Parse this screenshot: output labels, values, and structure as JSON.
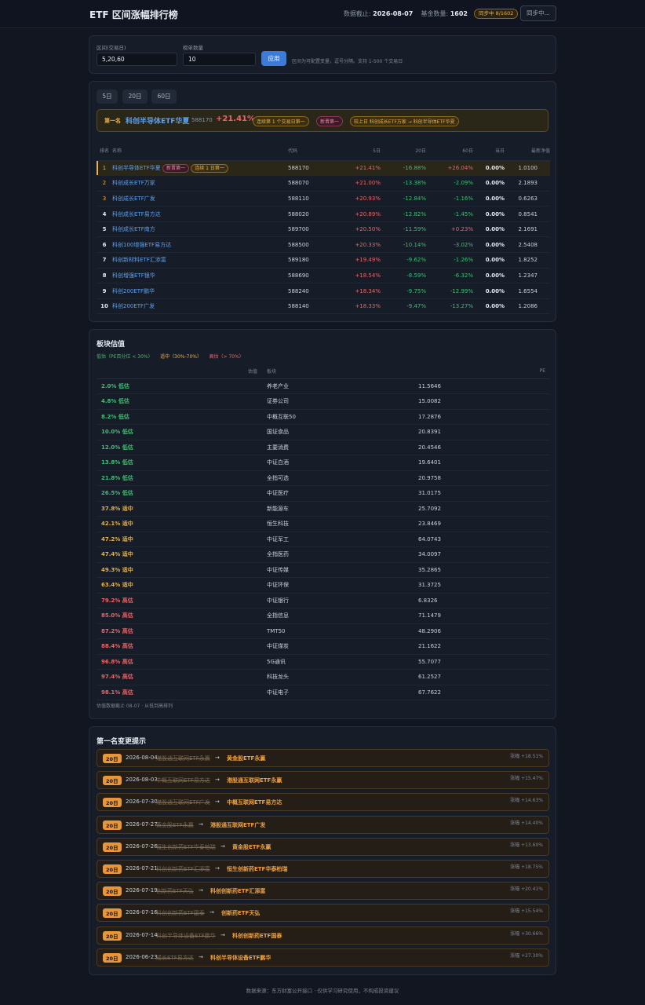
{
  "header": {
    "title": "ETF 区间涨幅排行榜",
    "date_label": "数据截止:",
    "date_value": "2026-08-07",
    "count_label": "基金数量:",
    "count_value": "1602",
    "sync_badge": "同步中 8/1602",
    "sync_button": "同步中..."
  },
  "controls": {
    "range_label": "区间(交易日)",
    "range_value": "5,20,60",
    "limit_label": "榜单数量",
    "limit_value": "10",
    "apply_label": "应用",
    "hint": "区间为可配置变量，逗号分隔。支持 1-500 个交易日"
  },
  "tabs": [
    "5日",
    "20日",
    "60日"
  ],
  "leader": {
    "prefix": "第一名",
    "name": "科创半导体ETF华夏",
    "code": "588170",
    "pct": "+21.41%",
    "pill1": "连续第 1 个交易日第一",
    "pill2": "新晋第一",
    "pill3": "较上日 科创成长ETF万家 → 科创半导体ETF华夏"
  },
  "rank_table": {
    "headers": [
      "排名",
      "名称",
      "代码",
      "5日",
      "20日",
      "60日",
      "当日",
      "最新净值"
    ],
    "rows": [
      {
        "rank": "1",
        "name": "科创半导体ETF华夏",
        "code": "588170",
        "d5": "+21.41%",
        "d20": "-16.88%",
        "d60": "+26.04%",
        "today": "0.00%",
        "nav": "1.0100",
        "tag1": "新晋第一",
        "tag2": "连续 1 日第一"
      },
      {
        "rank": "2",
        "name": "科创成长ETF万家",
        "code": "588070",
        "d5": "+21.00%",
        "d20": "-13.38%",
        "d60": "-2.09%",
        "today": "0.00%",
        "nav": "2.1893"
      },
      {
        "rank": "3",
        "name": "科创成长ETF广发",
        "code": "588110",
        "d5": "+20.93%",
        "d20": "-12.84%",
        "d60": "-1.16%",
        "today": "0.00%",
        "nav": "0.6263"
      },
      {
        "rank": "4",
        "name": "科创成长ETF易方达",
        "code": "588020",
        "d5": "+20.89%",
        "d20": "-12.82%",
        "d60": "-1.45%",
        "today": "0.00%",
        "nav": "0.8541"
      },
      {
        "rank": "5",
        "name": "科创成长ETF南方",
        "code": "589700",
        "d5": "+20.50%",
        "d20": "-11.59%",
        "d60": "+0.23%",
        "today": "0.00%",
        "nav": "2.1691"
      },
      {
        "rank": "6",
        "name": "科创100增强ETF易方达",
        "code": "588500",
        "d5": "+20.33%",
        "d20": "-10.14%",
        "d60": "-3.02%",
        "today": "0.00%",
        "nav": "2.5408"
      },
      {
        "rank": "7",
        "name": "科创新材料ETF汇添富",
        "code": "589180",
        "d5": "+19.49%",
        "d20": "-9.62%",
        "d60": "-1.26%",
        "today": "0.00%",
        "nav": "1.8252"
      },
      {
        "rank": "8",
        "name": "科创增强ETF银华",
        "code": "588690",
        "d5": "+18.54%",
        "d20": "-8.59%",
        "d60": "-6.32%",
        "today": "0.00%",
        "nav": "1.2347"
      },
      {
        "rank": "9",
        "name": "科创200ETF鹏华",
        "code": "588240",
        "d5": "+18.34%",
        "d20": "-9.75%",
        "d60": "-12.99%",
        "today": "0.00%",
        "nav": "1.6554"
      },
      {
        "rank": "10",
        "name": "科创200ETF广发",
        "code": "588140",
        "d5": "+18.33%",
        "d20": "-9.47%",
        "d60": "-13.27%",
        "today": "0.00%",
        "nav": "1.2086"
      }
    ]
  },
  "valuation": {
    "title": "板块估值",
    "legend_low": "低估（PE百分位 < 30%）",
    "legend_mid": "适中（30%-70%）",
    "legend_high": "高估（> 70%）",
    "headers": [
      "估值",
      "板块",
      "PE"
    ],
    "rows": [
      {
        "level": "2.0% 低估",
        "sector": "养老产业",
        "pe": "11.5646",
        "cls": "lv-low"
      },
      {
        "level": "4.8% 低估",
        "sector": "证券公司",
        "pe": "15.0082",
        "cls": "lv-low"
      },
      {
        "level": "8.2% 低估",
        "sector": "中概互联50",
        "pe": "17.2876",
        "cls": "lv-low"
      },
      {
        "level": "10.0% 低估",
        "sector": "国证食品",
        "pe": "20.8391",
        "cls": "lv-low"
      },
      {
        "level": "12.0% 低估",
        "sector": "主要消费",
        "pe": "20.4546",
        "cls": "lv-low"
      },
      {
        "level": "13.8% 低估",
        "sector": "中证白酒",
        "pe": "19.6401",
        "cls": "lv-low"
      },
      {
        "level": "21.8% 低估",
        "sector": "全指可选",
        "pe": "20.9758",
        "cls": "lv-low"
      },
      {
        "level": "26.5% 低估",
        "sector": "中证医疗",
        "pe": "31.0175",
        "cls": "lv-low"
      },
      {
        "level": "37.8% 适中",
        "sector": "新能源车",
        "pe": "25.7092",
        "cls": "lv-mid"
      },
      {
        "level": "42.1% 适中",
        "sector": "恒生科技",
        "pe": "23.8469",
        "cls": "lv-mid"
      },
      {
        "level": "47.2% 适中",
        "sector": "中证军工",
        "pe": "64.0743",
        "cls": "lv-mid"
      },
      {
        "level": "47.4% 适中",
        "sector": "全指医药",
        "pe": "34.0097",
        "cls": "lv-mid"
      },
      {
        "level": "49.3% 适中",
        "sector": "中证传媒",
        "pe": "35.2865",
        "cls": "lv-mid"
      },
      {
        "level": "63.4% 适中",
        "sector": "中证环保",
        "pe": "31.3725",
        "cls": "lv-mid"
      },
      {
        "level": "79.2% 高估",
        "sector": "中证银行",
        "pe": "6.8326",
        "cls": "lv-high"
      },
      {
        "level": "85.0% 高估",
        "sector": "全指信息",
        "pe": "71.1479",
        "cls": "lv-high"
      },
      {
        "level": "87.2% 高估",
        "sector": "TMT50",
        "pe": "48.2906",
        "cls": "lv-high"
      },
      {
        "level": "88.4% 高估",
        "sector": "中证煤炭",
        "pe": "21.1622",
        "cls": "lv-high"
      },
      {
        "level": "96.8% 高估",
        "sector": "5G通讯",
        "pe": "55.7077",
        "cls": "lv-high"
      },
      {
        "level": "97.4% 高估",
        "sector": "科技龙头",
        "pe": "61.2527",
        "cls": "lv-high"
      },
      {
        "level": "98.1% 高估",
        "sector": "中证电子",
        "pe": "67.7622",
        "cls": "lv-high"
      }
    ],
    "note": "估值数据截止 08-07 · 从低到高排列"
  },
  "changes": {
    "title": "第一名变更提示",
    "items": [
      {
        "tag": "20日",
        "date": "2026-08-04",
        "old": "港股通互联网ETF永赢",
        "new": "黄金股ETF永赢",
        "pct": "涨幅 +18.51%"
      },
      {
        "tag": "20日",
        "date": "2026-08-03",
        "old": "中概互联网ETF易方达",
        "new": "港股通互联网ETF永赢",
        "pct": "涨幅 +15.47%"
      },
      {
        "tag": "20日",
        "date": "2026-07-30",
        "old": "港股通互联网ETF广发",
        "new": "中概互联网ETF易方达",
        "pct": "涨幅 +14.63%"
      },
      {
        "tag": "20日",
        "date": "2026-07-27",
        "old": "黄金股ETF永赢",
        "new": "港股通互联网ETF广发",
        "pct": "涨幅 +14.40%"
      },
      {
        "tag": "20日",
        "date": "2026-07-26",
        "old": "恒生创新药ETF华泰柏瑞",
        "new": "黄金股ETF永赢",
        "pct": "涨幅 +13.60%"
      },
      {
        "tag": "20日",
        "date": "2026-07-21",
        "old": "科创创新药ETF汇添富",
        "new": "恒生创新药ETF华泰柏瑞",
        "pct": "涨幅 +18.75%"
      },
      {
        "tag": "20日",
        "date": "2026-07-19",
        "old": "创新药ETF天弘",
        "new": "科创创新药ETF汇添富",
        "pct": "涨幅 +20.41%"
      },
      {
        "tag": "20日",
        "date": "2026-07-16",
        "old": "科创创新药ETF国泰",
        "new": "创新药ETF天弘",
        "pct": "涨幅 +15.54%"
      },
      {
        "tag": "20日",
        "date": "2026-07-14",
        "old": "科创半导体设备ETF鹏华",
        "new": "科创创新药ETF国泰",
        "pct": "涨幅 +30.66%"
      },
      {
        "tag": "20日",
        "date": "2026-06-23",
        "old": "成长ETF易方达",
        "new": "科创半导体设备ETF鹏华",
        "pct": "涨幅 +27.30%"
      }
    ]
  },
  "footer": "数据来源：东方财富公开接口 · 仅供学习研究使用，不构成投资建议",
  "colors": {
    "up": "#f06464",
    "down": "#3fbf72",
    "accent": "#3d7bd9",
    "gold": "#e8b24a",
    "low": "#3fbf72",
    "mid": "#e8b24a",
    "high": "#f06464"
  },
  "icons": []
}
